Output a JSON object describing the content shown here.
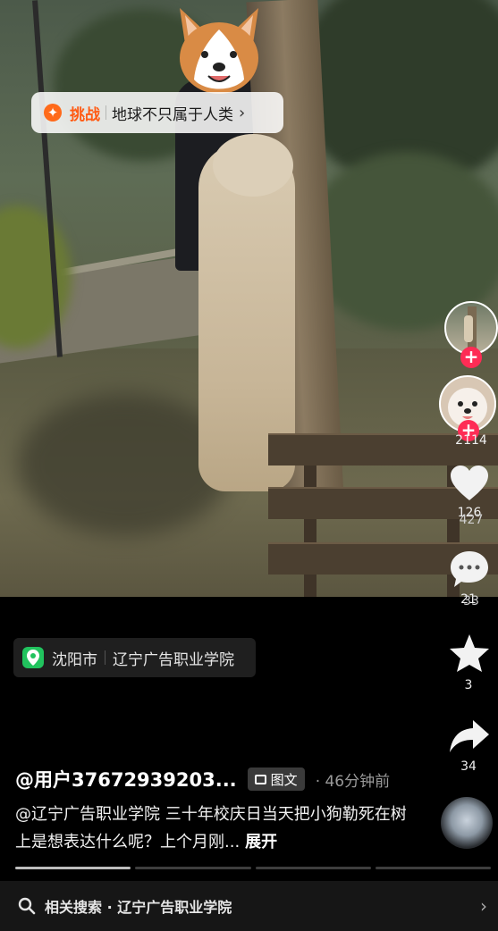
{
  "challenge": {
    "tag": "挑战",
    "title": "地球不只属于人类",
    "icon": "challenge-badge-icon"
  },
  "rail": {
    "creator_follow_symbol": "+",
    "profile_follow_symbol": "+",
    "profile_count": "2114",
    "likes": "126",
    "likes_overlay": "427",
    "comments": "21",
    "comments_overlay": "33",
    "favorites": "3",
    "shares": "34"
  },
  "location": {
    "city": "沈阳市",
    "place": "辽宁广告职业学院"
  },
  "post": {
    "author": "@用户37672939203...",
    "type_badge": "图文",
    "time": "· 46分钟前",
    "caption": "@辽宁广告职业学院 三十年校庆日当天把小狗勒死在树上是想表达什么呢？上个月刚...",
    "expand": "展开"
  },
  "progress": {
    "segments": 4,
    "active_index": 0
  },
  "related": {
    "text": "相关搜索 · 辽宁广告职业学院",
    "icon": "search-icon"
  },
  "colors": {
    "accent_red": "#fe2c55",
    "challenge_orange": "#ff5b14",
    "location_green": "#21c35e"
  }
}
